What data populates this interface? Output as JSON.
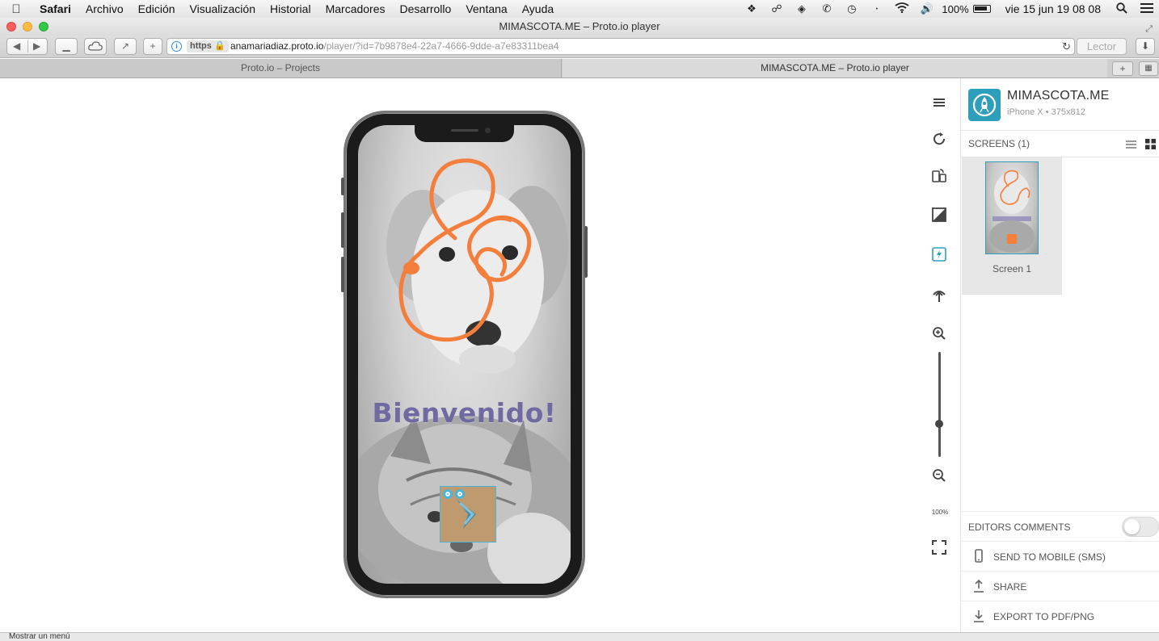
{
  "menubar": {
    "app": "Safari",
    "items": [
      "Archivo",
      "Edición",
      "Visualización",
      "Historial",
      "Marcadores",
      "Desarrollo",
      "Ventana",
      "Ayuda"
    ],
    "battery": "100%",
    "clock": "vie 15 jun  19 08 08"
  },
  "window": {
    "title": "MIMASCOTA.ME – Proto.io player"
  },
  "toolbar": {
    "url_scheme": "https",
    "url_host": "anamariadiaz.proto.io",
    "url_path": "/player/?id=7b9878e4-22a7-4666-9dde-a7e83311bea4",
    "reader_label": "Lector"
  },
  "tabs": [
    {
      "label": "Proto.io – Projects",
      "active": false
    },
    {
      "label": "MIMASCOTA.ME – Proto.io player",
      "active": true
    }
  ],
  "prototype": {
    "welcome_text": "Bienvenido!",
    "accent_color": "#f47f3c",
    "text_color": "#6f6a9f"
  },
  "tools": {
    "zoom_level": "100%",
    "icons": [
      "menu-icon",
      "refresh-icon",
      "rotate-device-icon",
      "contrast-icon",
      "hotspots-icon",
      "upload-icon",
      "zoom-in-icon",
      "zoom-out-icon",
      "fullscreen-icon"
    ]
  },
  "panel": {
    "project_title": "MIMASCOTA.ME",
    "device": "iPhone X • 375x812",
    "screens_label": "SCREENS (1)",
    "screens": [
      {
        "label": "Screen 1"
      }
    ],
    "editors_comments_label": "EDITORS COMMENTS",
    "editors_comments_on": false,
    "send_to_mobile": "SEND TO MOBILE (SMS)",
    "share": "SHARE",
    "export": "EXPORT TO PDF/PNG",
    "brand_color": "#2d9fbd"
  },
  "status": {
    "text": "Mostrar un menú"
  }
}
